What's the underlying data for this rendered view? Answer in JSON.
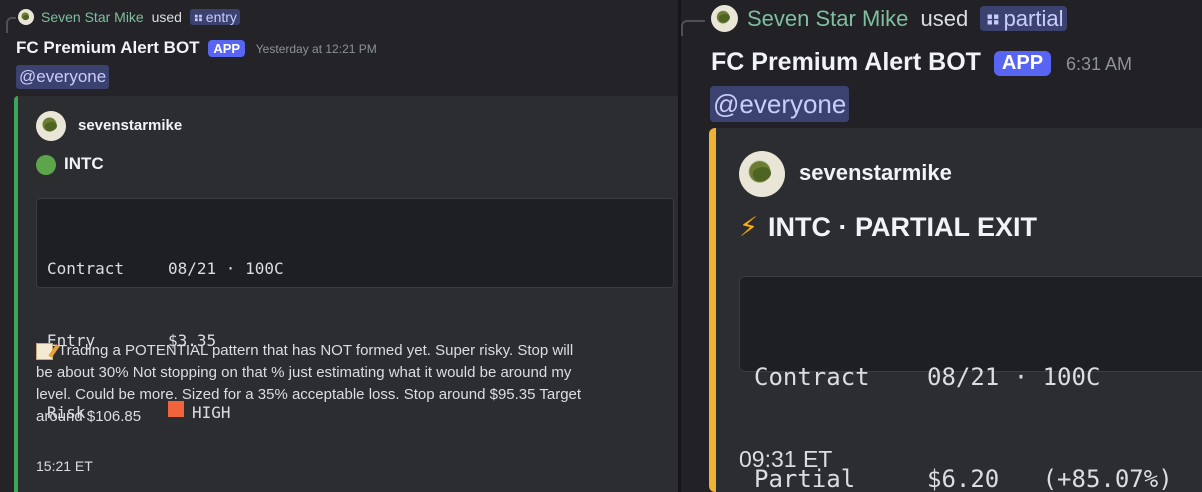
{
  "left": {
    "header": {
      "user": "Seven Star Mike",
      "used": "used",
      "command": "entry"
    },
    "bot_name": "FC Premium Alert BOT",
    "app_tag": "APP",
    "timestamp": "Yesterday at 12:21 PM",
    "mention": "@everyone",
    "embed": {
      "bar_color": "#3ba55c",
      "author": "sevenstarmike",
      "title": "INTC",
      "fields": [
        {
          "label": "Contract",
          "value": "08/21 · 100C"
        },
        {
          "label": "Entry",
          "value": "$3.35"
        },
        {
          "label": "Risk",
          "value": "HIGH"
        }
      ],
      "note_lines": [
        "Trading a POTENTIAL pattern that has NOT formed yet. Super risky. Stop will",
        "be about 30% Not stopping on that % just estimating what it would be around my",
        "level. Could be more. Sized for a 35% acceptable loss. Stop around $95.35 Target",
        "around $106.85"
      ],
      "footer": "15:21 ET"
    }
  },
  "right": {
    "header": {
      "user": "Seven Star Mike",
      "used": "used",
      "command": "partial"
    },
    "bot_name": "FC Premium Alert BOT",
    "app_tag": "APP",
    "timestamp": "6:31 AM",
    "mention": "@everyone",
    "embed": {
      "bar_color": "#f0b232",
      "author": "sevenstarmike",
      "title": "INTC · PARTIAL EXIT",
      "fields": [
        {
          "label": "Contract",
          "value": "08/21 · 100C"
        },
        {
          "label": "Partial",
          "value": "$6.20   (+85.07%)"
        }
      ],
      "footer": "09:31 ET"
    }
  }
}
